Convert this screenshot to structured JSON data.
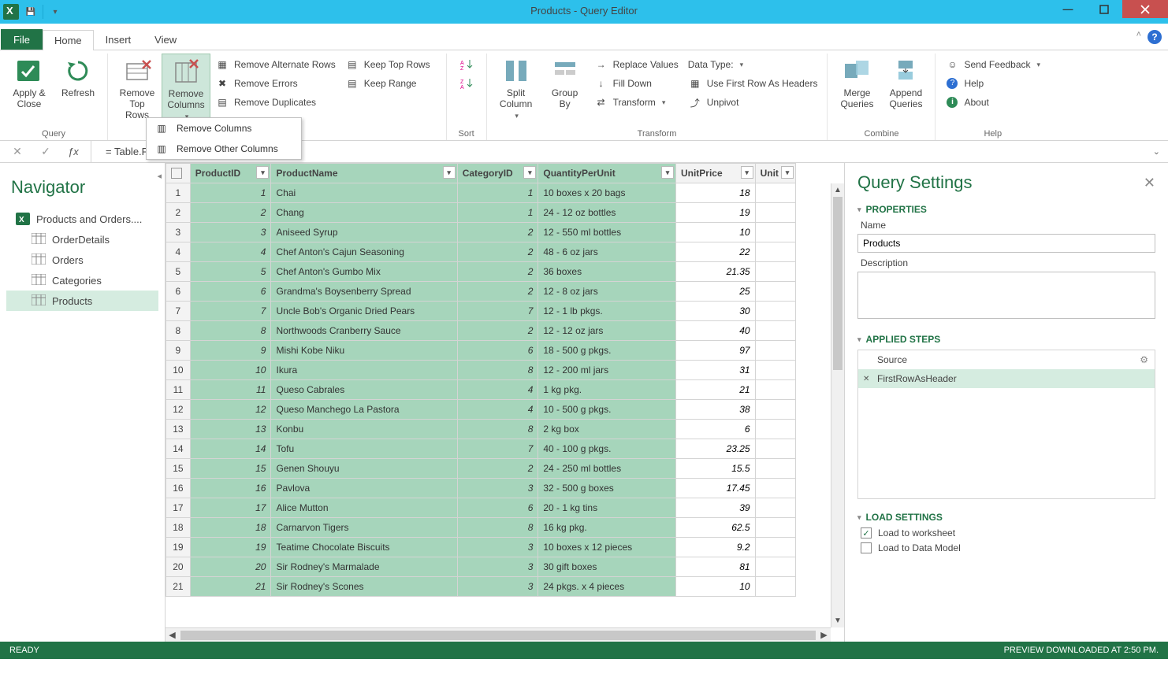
{
  "title": "Products - Query Editor",
  "tabs": {
    "file": "File",
    "home": "Home",
    "insert": "Insert",
    "view": "View"
  },
  "ribbon": {
    "group_query": "Query",
    "apply_close": "Apply & Close",
    "refresh": "Refresh",
    "remove_top_rows": "Remove Top Rows",
    "remove_columns": "Remove Columns",
    "remove_alternate_rows": "Remove Alternate Rows",
    "remove_errors": "Remove Errors",
    "remove_duplicates": "Remove Duplicates",
    "keep_top_rows": "Keep Top Rows",
    "keep_range": "Keep Range",
    "group_sort": "Sort",
    "split_column": "Split Column",
    "group_by": "Group By",
    "replace_values": "Replace Values",
    "fill_down": "Fill Down",
    "transform": "Transform",
    "data_type": "Data Type:",
    "first_row_headers": "Use First Row As Headers",
    "unpivot": "Unpivot",
    "group_transform": "Transform",
    "merge_queries": "Merge Queries",
    "append_queries": "Append Queries",
    "group_combine": "Combine",
    "send_feedback": "Send Feedback",
    "help": "Help",
    "about": "About",
    "group_help": "Help"
  },
  "dropdown": {
    "remove_columns": "Remove Columns",
    "remove_other_columns": "Remove Other Columns"
  },
  "formula": "= Table.PromoteHeaders(Products)",
  "navigator": {
    "title": "Navigator",
    "root": "Products and Orders....",
    "items": [
      "OrderDetails",
      "Orders",
      "Categories",
      "Products"
    ]
  },
  "columns": [
    "ProductID",
    "ProductName",
    "CategoryID",
    "QuantityPerUnit",
    "UnitPrice",
    "Unit"
  ],
  "rows": [
    {
      "n": 1,
      "id": 1,
      "name": "Chai",
      "cat": 1,
      "qpu": "10 boxes x 20 bags",
      "price": "18"
    },
    {
      "n": 2,
      "id": 2,
      "name": "Chang",
      "cat": 1,
      "qpu": "24 - 12 oz bottles",
      "price": "19"
    },
    {
      "n": 3,
      "id": 3,
      "name": "Aniseed Syrup",
      "cat": 2,
      "qpu": "12 - 550 ml bottles",
      "price": "10"
    },
    {
      "n": 4,
      "id": 4,
      "name": "Chef Anton's Cajun Seasoning",
      "cat": 2,
      "qpu": "48 - 6 oz jars",
      "price": "22"
    },
    {
      "n": 5,
      "id": 5,
      "name": "Chef Anton's Gumbo Mix",
      "cat": 2,
      "qpu": "36 boxes",
      "price": "21.35"
    },
    {
      "n": 6,
      "id": 6,
      "name": "Grandma's Boysenberry Spread",
      "cat": 2,
      "qpu": "12 - 8 oz jars",
      "price": "25"
    },
    {
      "n": 7,
      "id": 7,
      "name": "Uncle Bob's Organic Dried Pears",
      "cat": 7,
      "qpu": "12 - 1 lb pkgs.",
      "price": "30"
    },
    {
      "n": 8,
      "id": 8,
      "name": "Northwoods Cranberry Sauce",
      "cat": 2,
      "qpu": "12 - 12 oz jars",
      "price": "40"
    },
    {
      "n": 9,
      "id": 9,
      "name": "Mishi Kobe Niku",
      "cat": 6,
      "qpu": "18 - 500 g pkgs.",
      "price": "97"
    },
    {
      "n": 10,
      "id": 10,
      "name": "Ikura",
      "cat": 8,
      "qpu": "12 - 200 ml jars",
      "price": "31"
    },
    {
      "n": 11,
      "id": 11,
      "name": "Queso Cabrales",
      "cat": 4,
      "qpu": "1 kg pkg.",
      "price": "21"
    },
    {
      "n": 12,
      "id": 12,
      "name": "Queso Manchego La Pastora",
      "cat": 4,
      "qpu": "10 - 500 g pkgs.",
      "price": "38"
    },
    {
      "n": 13,
      "id": 13,
      "name": "Konbu",
      "cat": 8,
      "qpu": "2 kg box",
      "price": "6"
    },
    {
      "n": 14,
      "id": 14,
      "name": "Tofu",
      "cat": 7,
      "qpu": "40 - 100 g pkgs.",
      "price": "23.25"
    },
    {
      "n": 15,
      "id": 15,
      "name": "Genen Shouyu",
      "cat": 2,
      "qpu": "24 - 250 ml bottles",
      "price": "15.5"
    },
    {
      "n": 16,
      "id": 16,
      "name": "Pavlova",
      "cat": 3,
      "qpu": "32 - 500 g boxes",
      "price": "17.45"
    },
    {
      "n": 17,
      "id": 17,
      "name": "Alice Mutton",
      "cat": 6,
      "qpu": "20 - 1 kg tins",
      "price": "39"
    },
    {
      "n": 18,
      "id": 18,
      "name": "Carnarvon Tigers",
      "cat": 8,
      "qpu": "16 kg pkg.",
      "price": "62.5"
    },
    {
      "n": 19,
      "id": 19,
      "name": "Teatime Chocolate Biscuits",
      "cat": 3,
      "qpu": "10 boxes x 12 pieces",
      "price": "9.2"
    },
    {
      "n": 20,
      "id": 20,
      "name": "Sir Rodney's Marmalade",
      "cat": 3,
      "qpu": "30 gift boxes",
      "price": "81"
    }
  ],
  "settings": {
    "title": "Query Settings",
    "properties": "PROPERTIES",
    "name_label": "Name",
    "name_value": "Products",
    "description_label": "Description",
    "applied_steps": "APPLIED STEPS",
    "steps": [
      "Source",
      "FirstRowAsHeader"
    ],
    "load_settings": "LOAD SETTINGS",
    "load_worksheet": "Load to worksheet",
    "load_datamodel": "Load to Data Model"
  },
  "status": {
    "ready": "READY",
    "preview": "PREVIEW DOWNLOADED AT 2:50 PM."
  }
}
